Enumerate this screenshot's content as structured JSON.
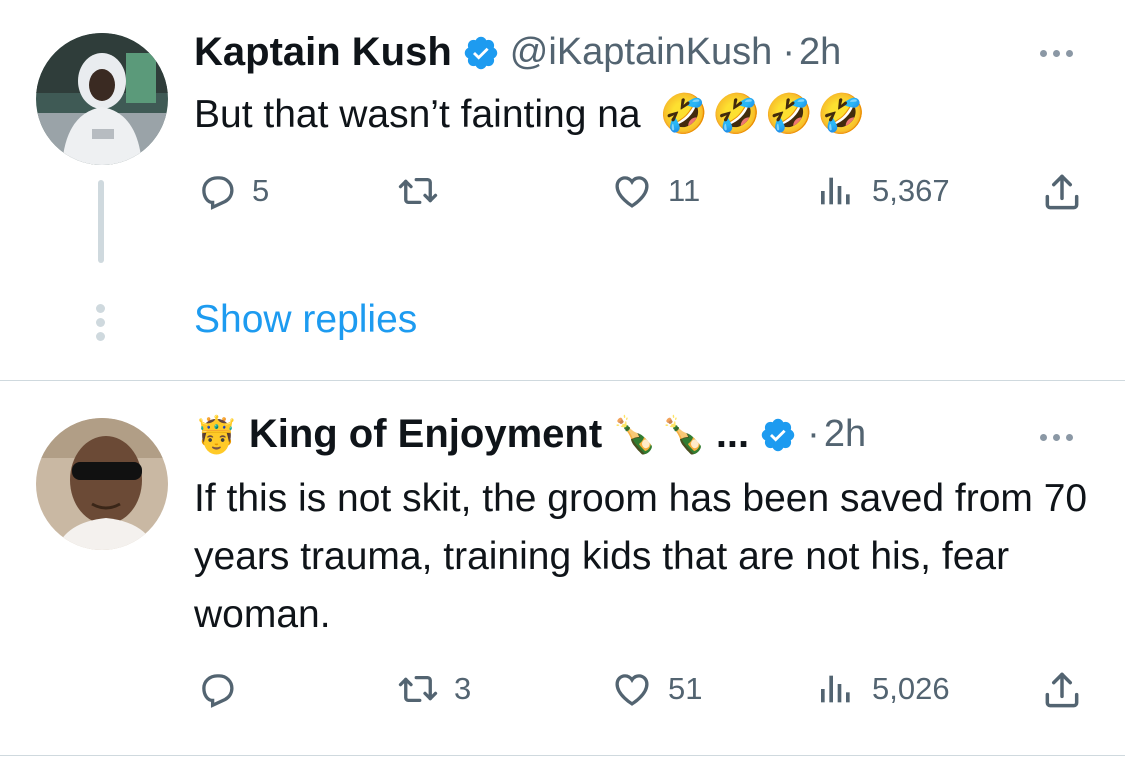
{
  "tweets": [
    {
      "name": "Kaptain Kush",
      "handle": "@iKaptainKush",
      "separator": "·",
      "time": "2h",
      "text": "But that wasn’t fainting na",
      "emojis": "🤣🤣🤣🤣",
      "replies": "5",
      "retweets": "",
      "likes": "11",
      "views": "5,367"
    },
    {
      "name_prefix_emoji": "🤴",
      "name": "King of Enjoyment",
      "name_suffix_emoji": "🍾🍾",
      "ellipsis": "...",
      "separator": "·",
      "time": "2h",
      "text": "If this is not skit, the groom has been saved from 70 years trauma, training kids that are not his, fear woman.",
      "replies": "",
      "retweets": "3",
      "likes": "51",
      "views": "5,026"
    }
  ],
  "thread": {
    "show_replies": "Show replies"
  },
  "colors": {
    "accent": "#1d9bf0",
    "verified": "#1d9bf0",
    "text": "#0f1419",
    "muted": "#536471"
  },
  "icons": [
    "reply-icon",
    "retweet-icon",
    "like-icon",
    "views-icon",
    "share-icon",
    "verified-badge-icon",
    "more-icon"
  ]
}
